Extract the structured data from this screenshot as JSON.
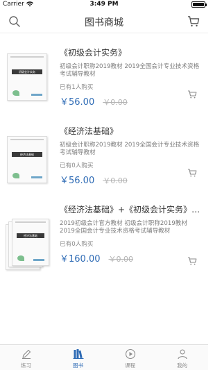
{
  "status_bar": {
    "carrier": "Carrier",
    "time": "3:49 PM"
  },
  "nav": {
    "title": "图书商城"
  },
  "colors": {
    "accent": "#2e6bb5",
    "muted": "#8c8c8c",
    "strike": "#b3b3b3"
  },
  "books": [
    {
      "name": "《初级会计实务》",
      "desc": "初级会计职称2019教材 2019全国会计专业技术资格考试辅导教材",
      "sold": "已有1人购买",
      "price": "￥56.00",
      "original_price": "￥0.00",
      "cover_title": "初级会计实务"
    },
    {
      "name": "《经济法基础》",
      "desc": "初级会计职称2019教材 2019全国会计专业技术资格考试辅导教材",
      "sold": "已有0人购买",
      "price": "￥56.00",
      "original_price": "￥0.00",
      "cover_title": "经济法基础"
    },
    {
      "name": "《经济法基础》+《初级会计实务》+...",
      "desc": "2019初级会计官方教材 初级会计职称2019教材 2019全国会计专业技术资格考试辅导教材",
      "sold": "已有0人购买",
      "price": "￥160.00",
      "original_price": "￥0.00",
      "cover_title": "经济法基础"
    }
  ],
  "tabs": [
    {
      "label": "练习",
      "icon": "pencil-icon",
      "active": false
    },
    {
      "label": "图书",
      "icon": "books-icon",
      "active": true
    },
    {
      "label": "课程",
      "icon": "play-circle-icon",
      "active": false
    },
    {
      "label": "我的",
      "icon": "person-icon",
      "active": false
    }
  ]
}
